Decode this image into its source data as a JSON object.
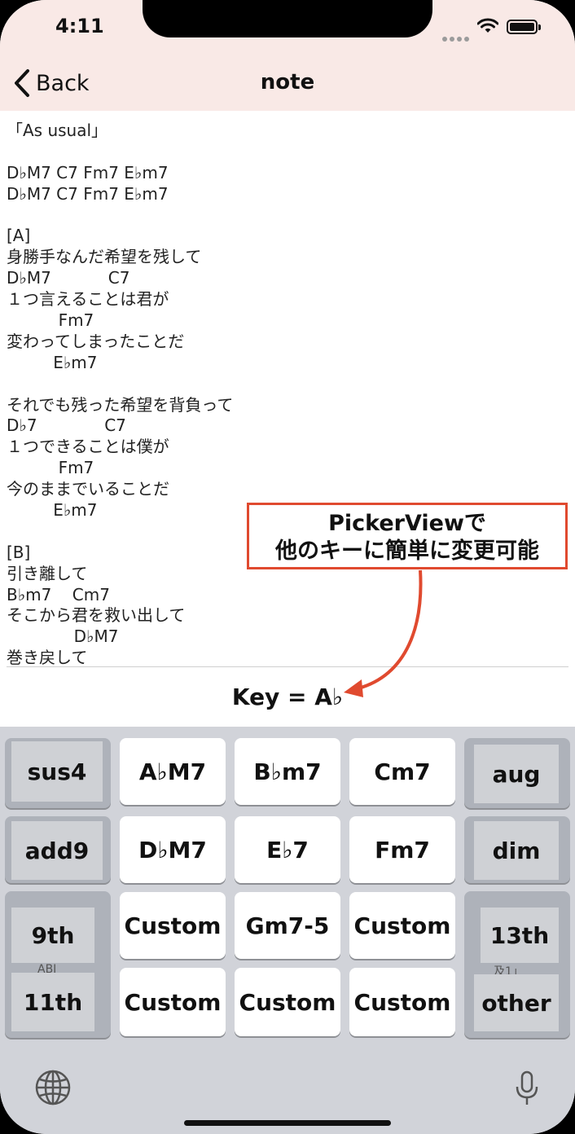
{
  "status": {
    "time": "4:11"
  },
  "nav": {
    "back_label": "Back",
    "title": "note"
  },
  "note_lines": [
    "「As usual」",
    "",
    "D♭M7 C7 Fm7 E♭m7",
    "D♭M7 C7 Fm7 E♭m7",
    "",
    "[A]",
    "身勝手なんだ希望を残して",
    "D♭M7           C7",
    "１つ言えることは君が",
    "          Fm7",
    "変わってしまったことだ",
    "         E♭m7",
    "",
    "それでも残った希望を背負って",
    "D♭7             C7",
    "１つできることは僕が",
    "          Fm7",
    "今のままでいることだ",
    "         E♭m7",
    "",
    "[B]",
    "引き離して",
    "B♭m7    Cm7",
    "そこから君を救い出して",
    "             D♭M7",
    "巻き戻して"
  ],
  "callout": {
    "line1": "PickerViewで",
    "line2": "他のキーに簡単に変更可能"
  },
  "key_display": "Key = A♭",
  "keyboard": {
    "left_keys": [
      "sus4",
      "add9",
      "9th",
      "11th"
    ],
    "right_keys": [
      "aug",
      "dim",
      "13th",
      "other"
    ],
    "chord_keys": [
      "A♭M7",
      "B♭m7",
      "Cm7",
      "D♭M7",
      "E♭7",
      "Fm7",
      "Custom",
      "Gm7-5",
      "Custom",
      "Custom",
      "Custom",
      "Custom"
    ],
    "peek_left": "ABI",
    "peek_right": "及1」"
  },
  "colors": {
    "nav_bg": "#f9e9e6",
    "callout_border": "#e04a2f",
    "keyboard_bg": "#d1d3d9"
  }
}
